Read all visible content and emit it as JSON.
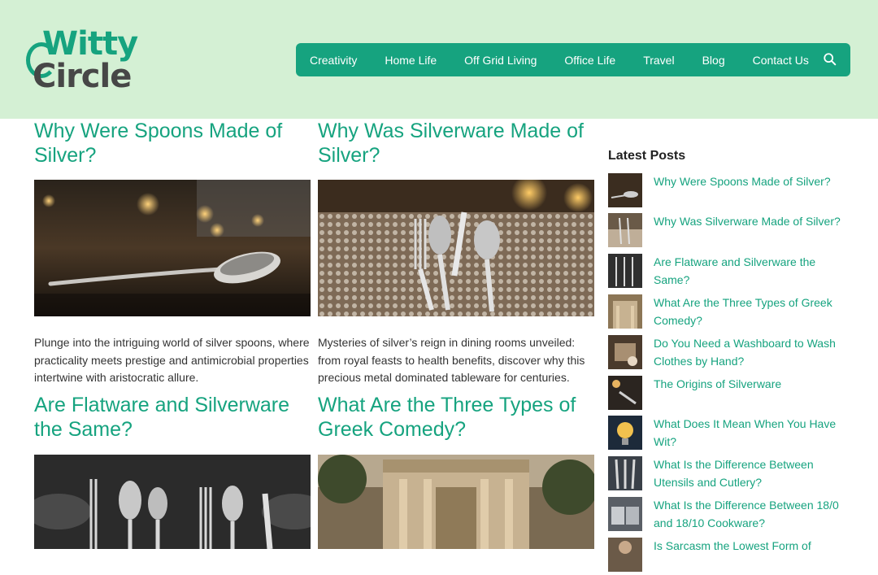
{
  "site": {
    "logo_top": "Witty",
    "logo_bottom": "Circle"
  },
  "nav": {
    "items": [
      "Creativity",
      "Home Life",
      "Off Grid Living",
      "Office Life",
      "Travel",
      "Blog",
      "Contact Us"
    ],
    "search_icon": "search-icon"
  },
  "posts": [
    {
      "title": "Why Were Spoons Made of Silver?",
      "excerpt": "Plunge into the intriguing world of silver spoons, where practicality meets prestige and antimicrobial properties intertwine with aristocratic allure."
    },
    {
      "title": "Why Was Silverware Made of Silver?",
      "excerpt": "Mysteries of silver’s reign in dining rooms unveiled: from royal feasts to health benefits, discover why this precious metal dominated tableware for centuries."
    },
    {
      "title": "Are Flatware and Silverware the Same?",
      "excerpt": ""
    },
    {
      "title": "What Are the Three Types of Greek Comedy?",
      "excerpt": ""
    }
  ],
  "sidebar": {
    "title": "Latest Posts",
    "items": [
      "Why Were Spoons Made of Silver?",
      "Why Was Silverware Made of Silver?",
      "Are Flatware and Silverware the Same?",
      "What Are the Three Types of Greek Comedy?",
      "Do You Need a Washboard to Wash Clothes by Hand?",
      "The Origins of Silverware",
      "What Does It Mean When You Have Wit?",
      "What Is the Difference Between Utensils and Cutlery?",
      "What Is the Difference Between 18/0 and 18/10 Cookware?",
      "Is Sarcasm the Lowest Form of"
    ]
  },
  "colors": {
    "brand_green": "#16a37f",
    "header_bg": "#d4f0d4",
    "logo_dark": "#474747"
  }
}
